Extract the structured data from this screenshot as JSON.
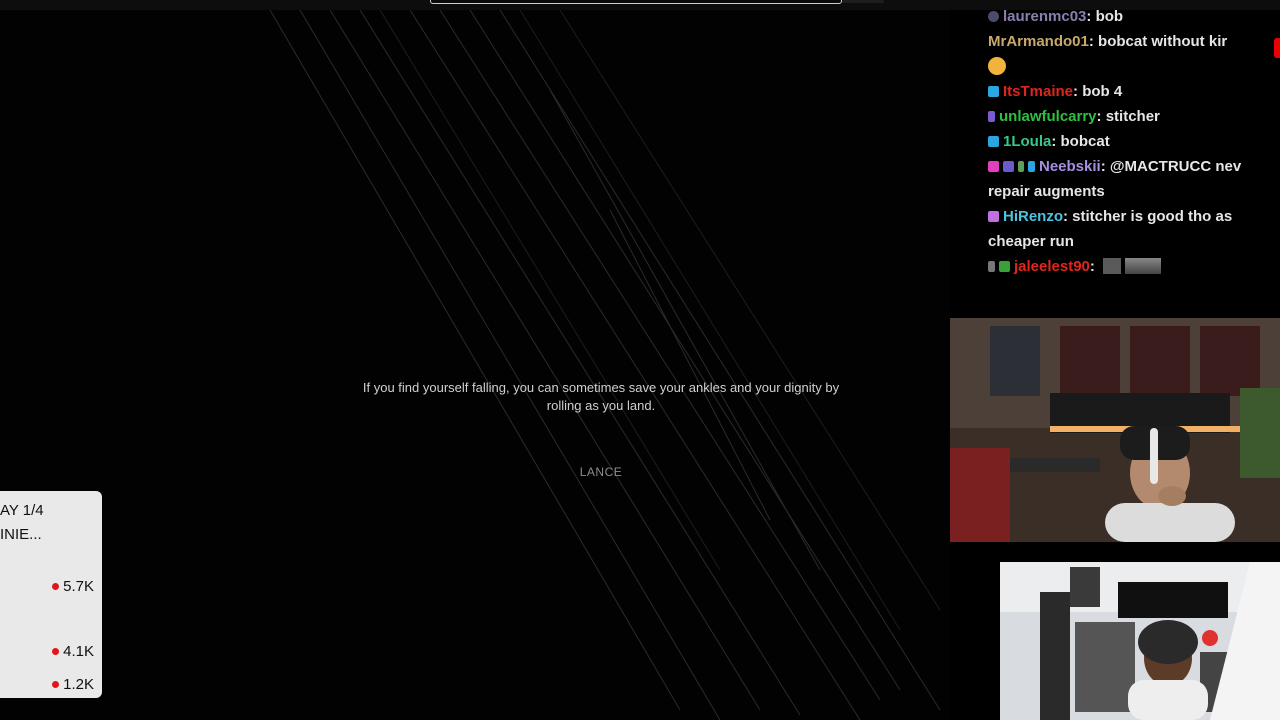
{
  "game": {
    "tip_text": "If you find yourself falling, you can sometimes save your ankles and your dignity by rolling as you land.",
    "tip_author": "LANCE"
  },
  "side_panel": {
    "line1": "AY 1/4",
    "line2": "INIE...",
    "stats": [
      "5.7K",
      "4.1K",
      "1.2K"
    ],
    "dot_color": "#e5141a"
  },
  "chat": {
    "messages": [
      {
        "user": "laurenmc03",
        "user_color": "#8a7fb0",
        "text": "bob",
        "badge": "circle-badge"
      },
      {
        "user": "MrArmando01",
        "user_color": "#c9a86b",
        "text": "bobcat without kir",
        "badge": ""
      },
      {
        "user": "",
        "user_color": "",
        "text": "",
        "badge": "sad-emoji"
      },
      {
        "user": "ItsTmaine",
        "user_color": "#e0251f",
        "text": "bob 4",
        "badge": "blue-badge"
      },
      {
        "user": "unlawfulcarry",
        "user_color": "#2fbf3f",
        "text": "stitcher",
        "badge": "purple-badge"
      },
      {
        "user": "1Loula",
        "user_color": "#37c98a",
        "text": "bobcat",
        "badge": "blue-badge"
      },
      {
        "user": "Neebskii",
        "user_color": "#a58fe0",
        "text": "@MACTRUCC nev",
        "badge": "multi-badge"
      },
      {
        "user": "",
        "user_color": "",
        "text": "repair augments",
        "badge": ""
      },
      {
        "user": "HiRenzo",
        "user_color": "#4cc3e0",
        "text": "stitcher is good tho as",
        "badge": "pink-badge"
      },
      {
        "user": "",
        "user_color": "",
        "text": "cheaper run",
        "badge": ""
      },
      {
        "user": "jaleelest90",
        "user_color": "#e0251f",
        "text": "",
        "badge": "multi-badge"
      }
    ]
  },
  "colors": {
    "background": "#000000",
    "tip_text": "#d0d0d0",
    "author_text": "#8d8d8d",
    "chat_text": "#e6e6e6"
  }
}
